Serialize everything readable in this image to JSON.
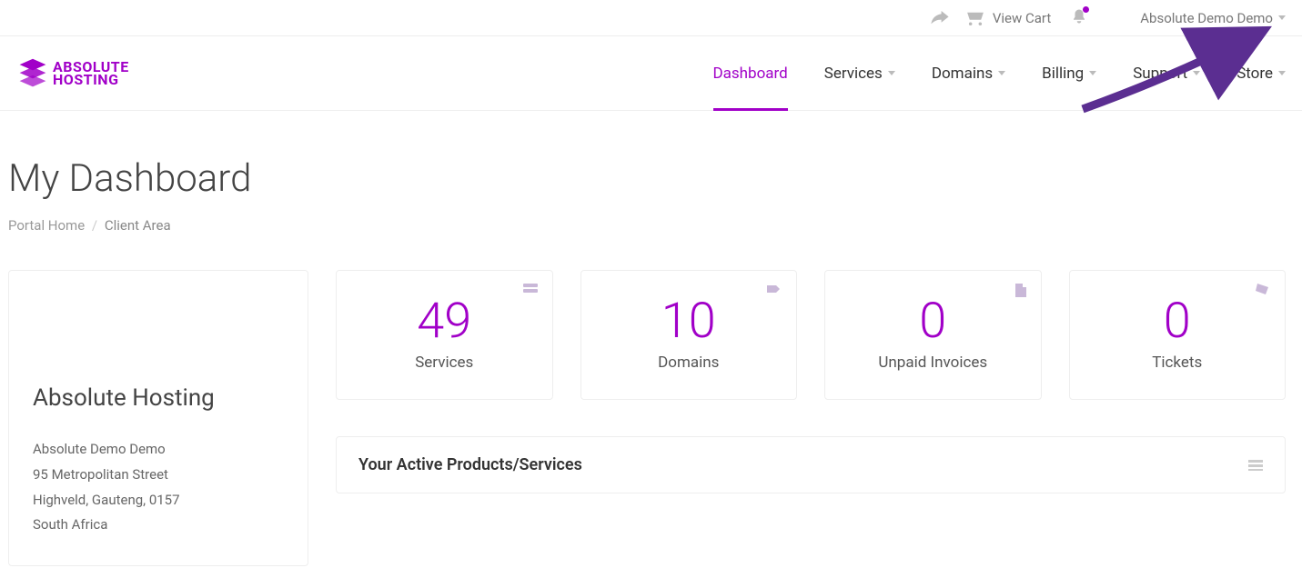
{
  "brand": {
    "line1": "ABSOLUTE",
    "line2": "HOSTING",
    "accent": "#a100c8"
  },
  "topbar": {
    "view_cart": "View Cart",
    "user_name": "Absolute Demo Demo"
  },
  "nav": {
    "dashboard": "Dashboard",
    "services": "Services",
    "domains": "Domains",
    "billing": "Billing",
    "support": "Support",
    "store": "Store"
  },
  "page": {
    "title": "My Dashboard",
    "breadcrumb_home": "Portal Home",
    "breadcrumb_current": "Client Area"
  },
  "profile": {
    "company": "Absolute Hosting",
    "name": "Absolute Demo Demo",
    "street": "95 Metropolitan Street",
    "city": "Highveld, Gauteng, 0157",
    "country": "South Africa"
  },
  "stats": {
    "services": {
      "count": "49",
      "label": "Services"
    },
    "domains": {
      "count": "10",
      "label": "Domains"
    },
    "invoices": {
      "count": "0",
      "label": "Unpaid Invoices"
    },
    "tickets": {
      "count": "0",
      "label": "Tickets"
    }
  },
  "panel": {
    "active_products_title": "Your Active Products/Services"
  }
}
